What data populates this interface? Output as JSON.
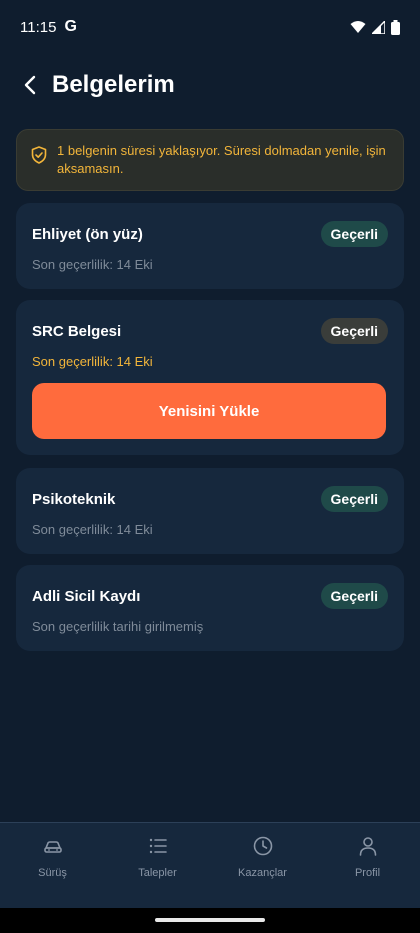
{
  "status_bar": {
    "time": "11:15",
    "g_icon_letter": "G"
  },
  "header": {
    "title": "Belgelerim",
    "back_icon": "chevron-left-icon"
  },
  "warning": {
    "text": "1 belgenin süresi yaklaşıyor. Süresi dolmadan yenile, işin aksamasın.",
    "color": "#f2b53a",
    "icon": "shield-check-icon"
  },
  "documents": [
    {
      "name": "Ehliyet (ön yüz)",
      "status": "Geçerli",
      "expiry": "Son geçerlilik: 14 Eki"
    },
    {
      "name": "SRC Belgesi",
      "status": "Geçerli",
      "expiry": "Son geçerlilik: 14 Eki",
      "action": "Yenisini Yükle"
    },
    {
      "name": "Psikoteknik",
      "status": "Geçerli",
      "expiry": "Son geçerlilik: 14 Eki"
    },
    {
      "name": "Adli Sicil Kaydı",
      "status": "Geçerli",
      "expiry": "Son geçerlilik tarihi girilmemiş"
    }
  ],
  "bottom_nav": [
    {
      "label": "Sürüş",
      "icon": "car-icon"
    },
    {
      "label": "Talepler",
      "icon": "list-icon"
    },
    {
      "label": "Kazançlar",
      "icon": "clock-icon"
    },
    {
      "label": "Profil",
      "icon": "user-icon"
    }
  ],
  "colors": {
    "background": "#0f1d2e",
    "card": "#16283d",
    "accent": "#ff6b3d",
    "badge_valid": "#1f4a49",
    "badge_expiring": "#3a3d3a",
    "warning": "#f2b53a"
  }
}
